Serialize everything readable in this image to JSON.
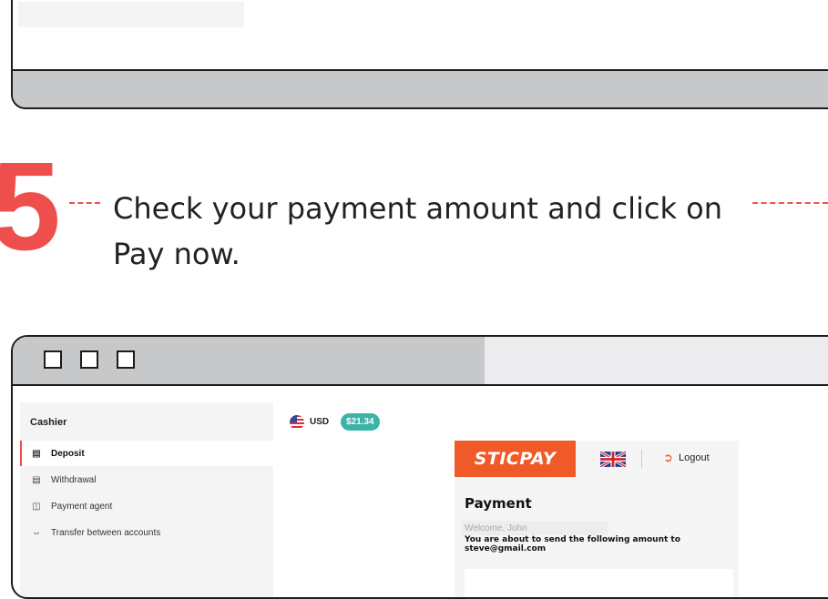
{
  "step": {
    "number": "5",
    "instruction_line1": "Check your payment amount and click on",
    "instruction_line2": "Pay now."
  },
  "sidebar": {
    "title": "Cashier",
    "items": [
      {
        "label": "Deposit",
        "icon": "wallet-icon",
        "active": true
      },
      {
        "label": "Withdrawal",
        "icon": "wallet-icon",
        "active": false
      },
      {
        "label": "Payment agent",
        "icon": "payment-agent-icon",
        "active": false
      },
      {
        "label": "Transfer between accounts",
        "icon": "transfer-icon",
        "active": false
      }
    ]
  },
  "account": {
    "currency": "USD",
    "balance": "$21.34"
  },
  "sticpay": {
    "logo": "STICPAY",
    "logout_label": "Logout",
    "title": "Payment",
    "welcome": "Welcome, John",
    "message": "You are about to send the following amount to",
    "email": "steve@gmail.com"
  },
  "colors": {
    "accent_red": "#ef4f4c",
    "sticpay_orange": "#ef5a28",
    "badge_teal": "#3bb3aa",
    "titlebar_gray": "#c7c8ca"
  }
}
